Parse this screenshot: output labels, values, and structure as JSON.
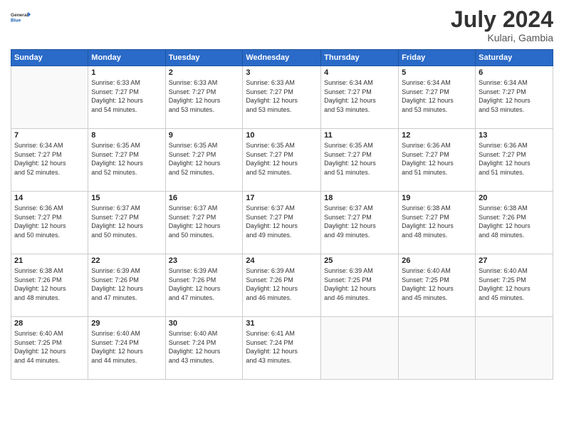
{
  "logo": {
    "general": "General",
    "blue": "Blue"
  },
  "header": {
    "month": "July 2024",
    "location": "Kulari, Gambia"
  },
  "weekdays": [
    "Sunday",
    "Monday",
    "Tuesday",
    "Wednesday",
    "Thursday",
    "Friday",
    "Saturday"
  ],
  "weeks": [
    [
      {
        "day": "",
        "info": ""
      },
      {
        "day": "1",
        "info": "Sunrise: 6:33 AM\nSunset: 7:27 PM\nDaylight: 12 hours\nand 54 minutes."
      },
      {
        "day": "2",
        "info": "Sunrise: 6:33 AM\nSunset: 7:27 PM\nDaylight: 12 hours\nand 53 minutes."
      },
      {
        "day": "3",
        "info": "Sunrise: 6:33 AM\nSunset: 7:27 PM\nDaylight: 12 hours\nand 53 minutes."
      },
      {
        "day": "4",
        "info": "Sunrise: 6:34 AM\nSunset: 7:27 PM\nDaylight: 12 hours\nand 53 minutes."
      },
      {
        "day": "5",
        "info": "Sunrise: 6:34 AM\nSunset: 7:27 PM\nDaylight: 12 hours\nand 53 minutes."
      },
      {
        "day": "6",
        "info": "Sunrise: 6:34 AM\nSunset: 7:27 PM\nDaylight: 12 hours\nand 53 minutes."
      }
    ],
    [
      {
        "day": "7",
        "info": "Sunrise: 6:34 AM\nSunset: 7:27 PM\nDaylight: 12 hours\nand 52 minutes."
      },
      {
        "day": "8",
        "info": "Sunrise: 6:35 AM\nSunset: 7:27 PM\nDaylight: 12 hours\nand 52 minutes."
      },
      {
        "day": "9",
        "info": "Sunrise: 6:35 AM\nSunset: 7:27 PM\nDaylight: 12 hours\nand 52 minutes."
      },
      {
        "day": "10",
        "info": "Sunrise: 6:35 AM\nSunset: 7:27 PM\nDaylight: 12 hours\nand 52 minutes."
      },
      {
        "day": "11",
        "info": "Sunrise: 6:35 AM\nSunset: 7:27 PM\nDaylight: 12 hours\nand 51 minutes."
      },
      {
        "day": "12",
        "info": "Sunrise: 6:36 AM\nSunset: 7:27 PM\nDaylight: 12 hours\nand 51 minutes."
      },
      {
        "day": "13",
        "info": "Sunrise: 6:36 AM\nSunset: 7:27 PM\nDaylight: 12 hours\nand 51 minutes."
      }
    ],
    [
      {
        "day": "14",
        "info": "Sunrise: 6:36 AM\nSunset: 7:27 PM\nDaylight: 12 hours\nand 50 minutes."
      },
      {
        "day": "15",
        "info": "Sunrise: 6:37 AM\nSunset: 7:27 PM\nDaylight: 12 hours\nand 50 minutes."
      },
      {
        "day": "16",
        "info": "Sunrise: 6:37 AM\nSunset: 7:27 PM\nDaylight: 12 hours\nand 50 minutes."
      },
      {
        "day": "17",
        "info": "Sunrise: 6:37 AM\nSunset: 7:27 PM\nDaylight: 12 hours\nand 49 minutes."
      },
      {
        "day": "18",
        "info": "Sunrise: 6:37 AM\nSunset: 7:27 PM\nDaylight: 12 hours\nand 49 minutes."
      },
      {
        "day": "19",
        "info": "Sunrise: 6:38 AM\nSunset: 7:27 PM\nDaylight: 12 hours\nand 48 minutes."
      },
      {
        "day": "20",
        "info": "Sunrise: 6:38 AM\nSunset: 7:26 PM\nDaylight: 12 hours\nand 48 minutes."
      }
    ],
    [
      {
        "day": "21",
        "info": "Sunrise: 6:38 AM\nSunset: 7:26 PM\nDaylight: 12 hours\nand 48 minutes."
      },
      {
        "day": "22",
        "info": "Sunrise: 6:39 AM\nSunset: 7:26 PM\nDaylight: 12 hours\nand 47 minutes."
      },
      {
        "day": "23",
        "info": "Sunrise: 6:39 AM\nSunset: 7:26 PM\nDaylight: 12 hours\nand 47 minutes."
      },
      {
        "day": "24",
        "info": "Sunrise: 6:39 AM\nSunset: 7:26 PM\nDaylight: 12 hours\nand 46 minutes."
      },
      {
        "day": "25",
        "info": "Sunrise: 6:39 AM\nSunset: 7:25 PM\nDaylight: 12 hours\nand 46 minutes."
      },
      {
        "day": "26",
        "info": "Sunrise: 6:40 AM\nSunset: 7:25 PM\nDaylight: 12 hours\nand 45 minutes."
      },
      {
        "day": "27",
        "info": "Sunrise: 6:40 AM\nSunset: 7:25 PM\nDaylight: 12 hours\nand 45 minutes."
      }
    ],
    [
      {
        "day": "28",
        "info": "Sunrise: 6:40 AM\nSunset: 7:25 PM\nDaylight: 12 hours\nand 44 minutes."
      },
      {
        "day": "29",
        "info": "Sunrise: 6:40 AM\nSunset: 7:24 PM\nDaylight: 12 hours\nand 44 minutes."
      },
      {
        "day": "30",
        "info": "Sunrise: 6:40 AM\nSunset: 7:24 PM\nDaylight: 12 hours\nand 43 minutes."
      },
      {
        "day": "31",
        "info": "Sunrise: 6:41 AM\nSunset: 7:24 PM\nDaylight: 12 hours\nand 43 minutes."
      },
      {
        "day": "",
        "info": ""
      },
      {
        "day": "",
        "info": ""
      },
      {
        "day": "",
        "info": ""
      }
    ]
  ]
}
